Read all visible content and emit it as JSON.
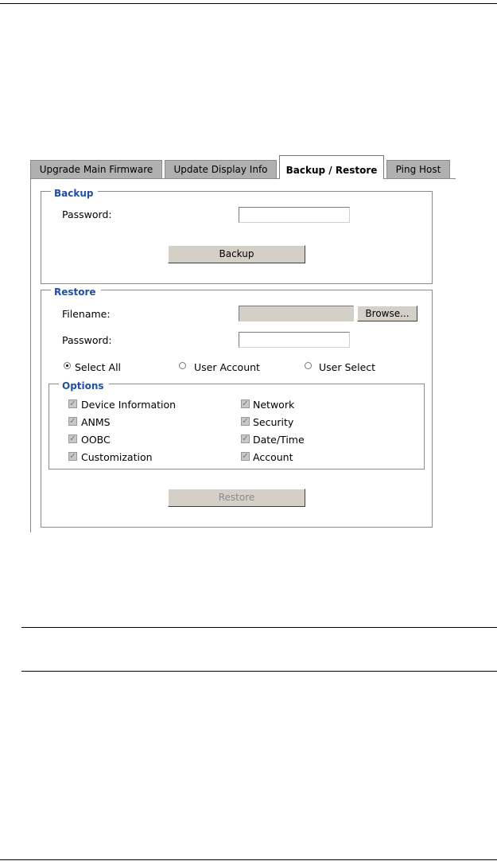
{
  "tabs": [
    "Upgrade Main Firmware",
    "Update Display Info",
    "Backup / Restore",
    "Ping Host"
  ],
  "backup": {
    "legend": "Backup",
    "password_label": "Password:",
    "password_value": "",
    "button": "Backup"
  },
  "restore": {
    "legend": "Restore",
    "filename_label": "Filename:",
    "filename_value": "",
    "browse": "Browse...",
    "password_label": "Password:",
    "password_value": "",
    "radios": [
      "Select All",
      "User Account",
      "User Select"
    ],
    "selected_radio": "Select All",
    "options_legend": "Options",
    "options": [
      "Device Information",
      "Network",
      "ANMS",
      "Security",
      "OOBC",
      "Date/Time",
      "Customization",
      "Account"
    ],
    "button": "Restore"
  }
}
